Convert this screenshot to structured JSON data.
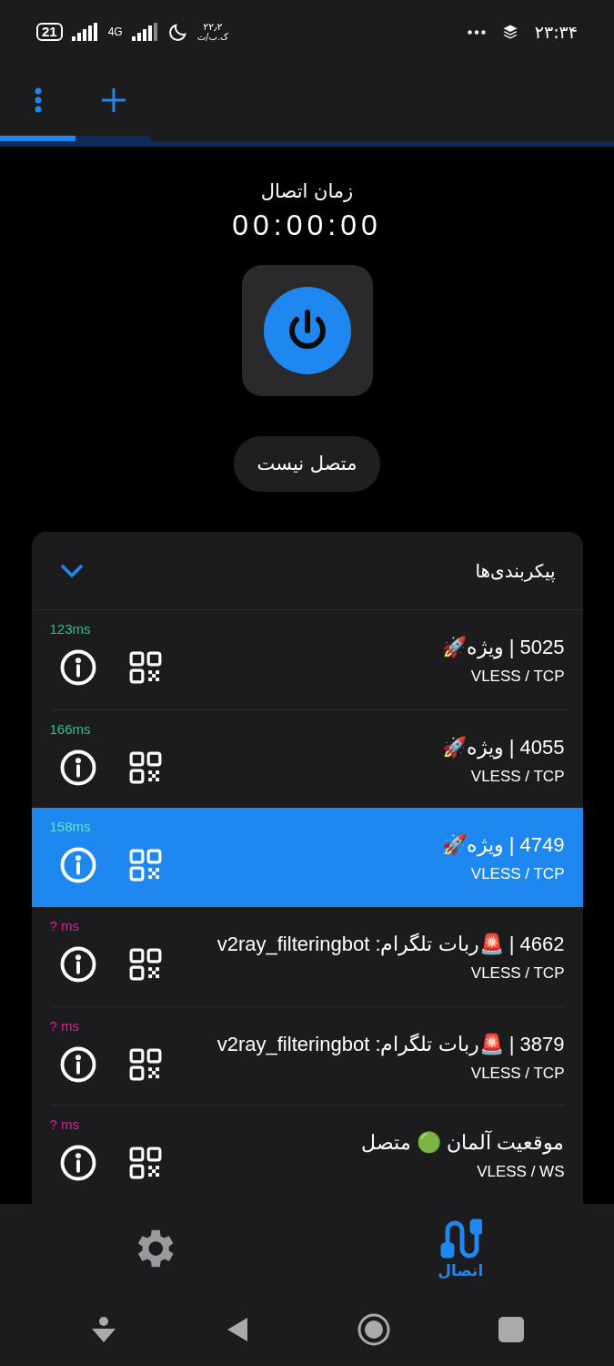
{
  "status_bar": {
    "battery": "21",
    "network": "4G",
    "date_top": "۲۲٫۲",
    "date_bottom": "ک.ب/ث",
    "time": "۲۳:۳۴"
  },
  "tabs": [
    {
      "kind": "menu",
      "selected": true
    },
    {
      "kind": "add",
      "selected": false
    }
  ],
  "connection": {
    "label": "زمان اتصال",
    "timer": "00:00:00",
    "connected": false,
    "status": "متصل نیست"
  },
  "configs": {
    "title": "پیکربندی‌ها",
    "expanded": true,
    "items": [
      {
        "name": "5025 | ویژه🚀",
        "protocol": "VLESS / TCP",
        "ping": "123ms",
        "ping_ok": true,
        "selected": false
      },
      {
        "name": "4055 | ویژه🚀",
        "protocol": "VLESS / TCP",
        "ping": "166ms",
        "ping_ok": true,
        "selected": false
      },
      {
        "name": "4749 | ویژه🚀",
        "protocol": "VLESS / TCP",
        "ping": "158ms",
        "ping_ok": true,
        "selected": true
      },
      {
        "name": "4662 | 🚨ربات تلگرام: v2ray_filteringbot",
        "protocol": "VLESS / TCP",
        "ping": "? ms",
        "ping_ok": false,
        "selected": false
      },
      {
        "name": "3879 | 🚨ربات تلگرام: v2ray_filteringbot",
        "protocol": "VLESS / TCP",
        "ping": "? ms",
        "ping_ok": false,
        "selected": false
      },
      {
        "name": "موقعیت آلمان 🟢 متصل",
        "protocol": "VLESS / WS",
        "ping": "? ms",
        "ping_ok": false,
        "selected": false
      }
    ]
  },
  "bottom_nav": [
    {
      "kind": "settings",
      "selected": false
    },
    {
      "kind": "connect",
      "label": "اتصال",
      "selected": true
    }
  ]
}
